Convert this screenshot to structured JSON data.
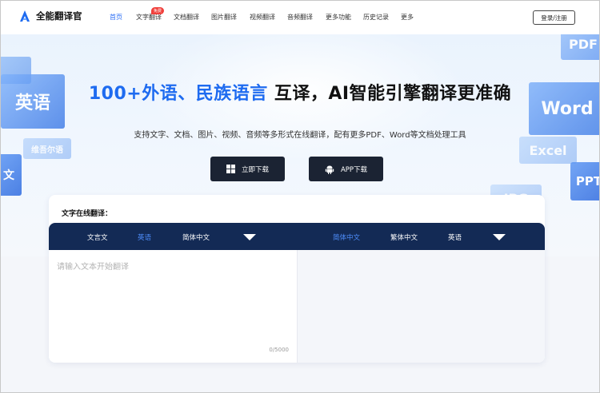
{
  "brand": {
    "name": "全能翻译官",
    "accent": "#2b6ef5"
  },
  "nav": {
    "items": [
      {
        "label": "首页",
        "active": true
      },
      {
        "label": "文字翻译",
        "badge": "免费"
      },
      {
        "label": "文档翻译"
      },
      {
        "label": "图片翻译"
      },
      {
        "label": "视频翻译"
      },
      {
        "label": "音频翻译"
      },
      {
        "label": "更多功能"
      },
      {
        "label": "历史记录"
      },
      {
        "label": "更多"
      }
    ],
    "login": "登录/注册"
  },
  "hero": {
    "headline_part1": "100+外语、民族语言",
    "headline_part2": "互译，AI智能引擎翻译更准确",
    "subtitle": "支持文字、文档、图片、视频、音频等多形式在线翻译，配有更多PDF、Word等文档处理工具",
    "download_btn": "立即下载",
    "app_btn": "APP下载",
    "deco_left": [
      "英语",
      "维吾尔语",
      "文"
    ],
    "deco_right": [
      "PDF",
      "Word",
      "Excel",
      "PPT",
      "JPG"
    ]
  },
  "translator": {
    "title": "文字在线翻译：",
    "source_langs": [
      "文言文",
      "英语",
      "简体中文"
    ],
    "source_selected": "英语",
    "target_langs": [
      "简体中文",
      "繁体中文",
      "英语"
    ],
    "target_selected": "简体中文",
    "placeholder": "请输入文本开始翻译",
    "char_count": "0/5000"
  }
}
